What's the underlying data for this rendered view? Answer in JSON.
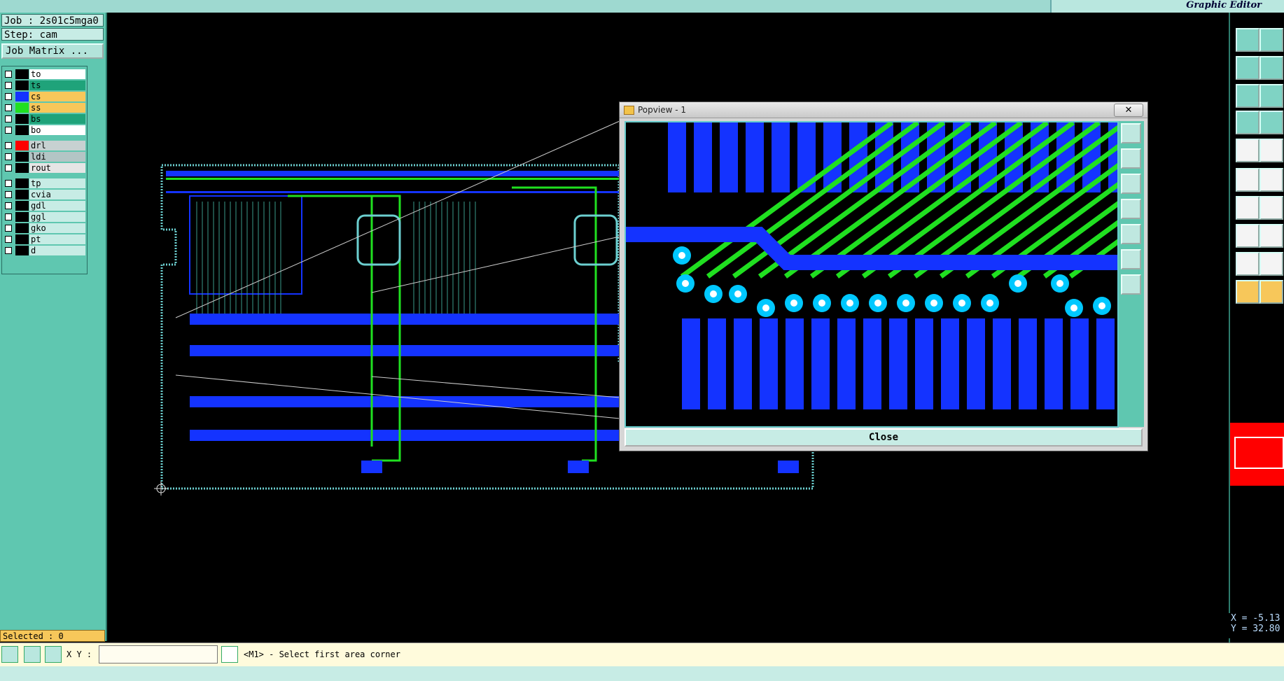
{
  "app": {
    "subtitle": "Graphic Editor"
  },
  "info": {
    "job": "Job : 2s01c5mga0",
    "step": "Step: cam",
    "job_matrix": "Job Matrix ..."
  },
  "layers": [
    {
      "name": "to",
      "color": "#ffffff"
    },
    {
      "name": "ts",
      "color": "#1fa37a"
    },
    {
      "name": "cs",
      "color": "#f7c75a"
    },
    {
      "name": "ss",
      "color": "#f7c75a"
    },
    {
      "name": "bs",
      "color": "#1fa37a"
    },
    {
      "name": "bo",
      "color": "#ffffff"
    },
    {
      "name": "drl",
      "color": "#c7d1d1"
    },
    {
      "name": "ldi",
      "color": "#b3c5c5"
    },
    {
      "name": "rout",
      "color": "#e5e5e5"
    },
    {
      "name": "tp",
      "color": "#c7ece5"
    },
    {
      "name": "cvia",
      "color": "#c7ece5"
    },
    {
      "name": "gdl",
      "color": "#c7ece5"
    },
    {
      "name": "ggl",
      "color": "#c7ece5"
    },
    {
      "name": "gko",
      "color": "#c7ece5"
    },
    {
      "name": "pt",
      "color": "#c7ece5"
    },
    {
      "name": "d",
      "color": "#c7ece5"
    }
  ],
  "selected": "Selected : 0",
  "statusbar": {
    "xy_label": "X Y :",
    "xy_value": "",
    "message": "<M1> - Select first area corner"
  },
  "coords": {
    "x": "X = -5.13",
    "y": "Y = 32.80"
  },
  "popview": {
    "title": "Popview - 1",
    "close_x": "✕",
    "close_label": "Close"
  },
  "colors": {
    "panel": "#5fc7b0",
    "accent": "#7fd3c4",
    "trace_blue": "#1433ff",
    "trace_green": "#20e020",
    "pad_cyan": "#00c8ff"
  }
}
